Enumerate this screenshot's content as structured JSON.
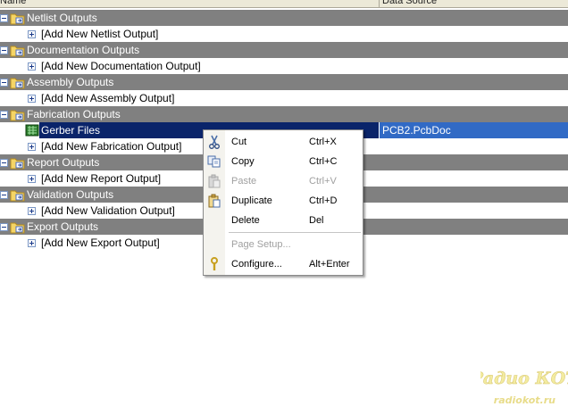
{
  "columns": {
    "name": "Name",
    "data_source": "Data Source"
  },
  "tree": {
    "groups": [
      {
        "label": "Netlist Outputs",
        "add": "[Add New Netlist Output]"
      },
      {
        "label": "Documentation Outputs",
        "add": "[Add New Documentation Output]"
      },
      {
        "label": "Assembly Outputs",
        "add": "[Add New Assembly Output]"
      },
      {
        "label": "Fabrication Outputs",
        "item": {
          "name": "Gerber Files",
          "data_source": "PCB2.PcbDoc"
        },
        "add": "[Add New Fabrication Output]"
      },
      {
        "label": "Report Outputs",
        "add": "[Add New Report Output]"
      },
      {
        "label": "Validation Outputs",
        "add": "[Add New Validation Output]"
      },
      {
        "label": "Export Outputs",
        "add": "[Add New Export Output]"
      }
    ]
  },
  "context_menu": {
    "items": [
      {
        "label": "Cut",
        "shortcut": "Ctrl+X",
        "icon": "scissors-icon",
        "enabled": true
      },
      {
        "label": "Copy",
        "shortcut": "Ctrl+C",
        "icon": "copy-icon",
        "enabled": true
      },
      {
        "label": "Paste",
        "shortcut": "Ctrl+V",
        "icon": "paste-icon",
        "enabled": false
      },
      {
        "label": "Duplicate",
        "shortcut": "Ctrl+D",
        "icon": "duplicate-icon",
        "enabled": true
      },
      {
        "label": "Delete",
        "shortcut": "Del",
        "icon": "",
        "enabled": true
      },
      {
        "label": "Page Setup...",
        "shortcut": "",
        "icon": "",
        "enabled": false
      },
      {
        "label": "Configure...",
        "shortcut": "Alt+Enter",
        "icon": "wrench-icon",
        "enabled": true
      }
    ]
  },
  "watermark": {
    "title": "Радио КОТ",
    "url": "radiokot.ru"
  },
  "colors": {
    "group_row": "#808080",
    "selection": "#0a246a",
    "selection_secondary": "#316ac5"
  }
}
